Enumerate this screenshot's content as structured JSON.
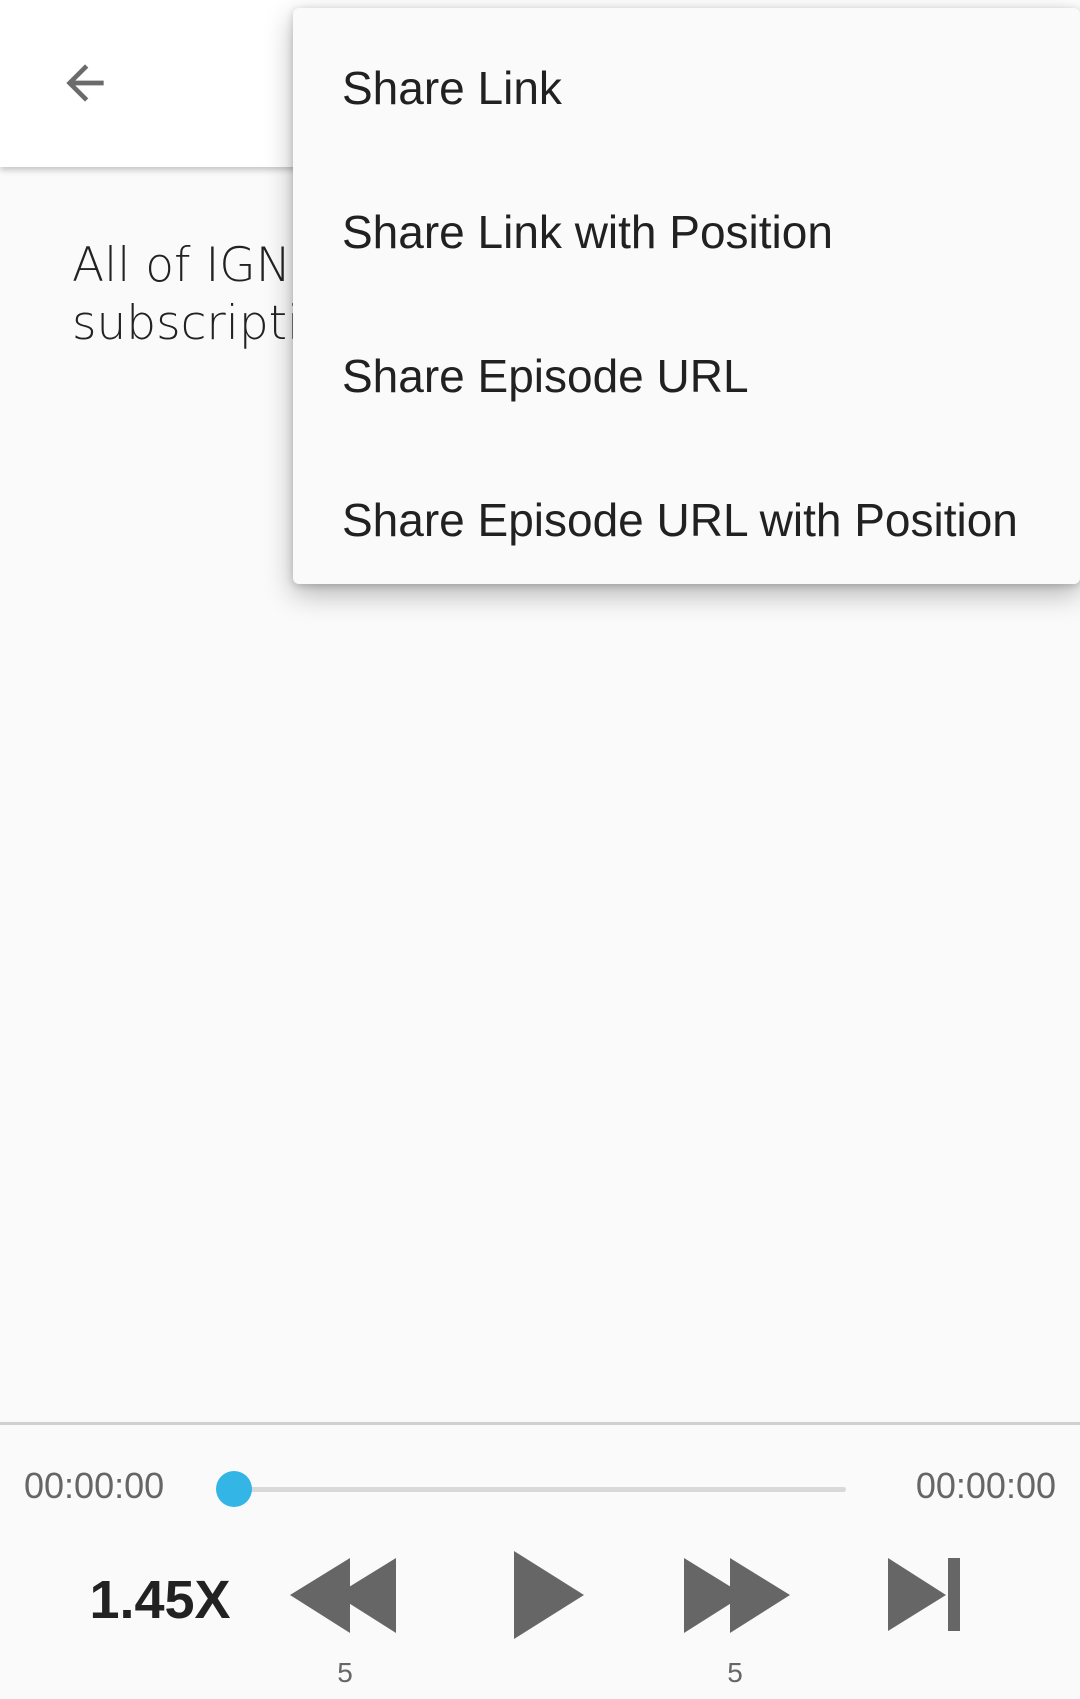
{
  "app_bar": {
    "back_icon": "arrow-left-icon"
  },
  "content": {
    "description": "All of IGN'\nsubscripti"
  },
  "share_menu": {
    "items": [
      {
        "label": "Share Link"
      },
      {
        "label": "Share Link with Position"
      },
      {
        "label": "Share Episode URL"
      },
      {
        "label": "Share Episode URL with Position"
      }
    ]
  },
  "player": {
    "elapsed": "00:00:00",
    "total": "00:00:00",
    "progress": 0,
    "speed": "1.45X",
    "rewind_seconds": "5",
    "forward_seconds": "5",
    "accent_color": "#33b5e5",
    "icons": {
      "rewind": "rewind-icon",
      "play": "play-icon",
      "forward": "fast-forward-icon",
      "skip": "skip-next-icon"
    }
  }
}
